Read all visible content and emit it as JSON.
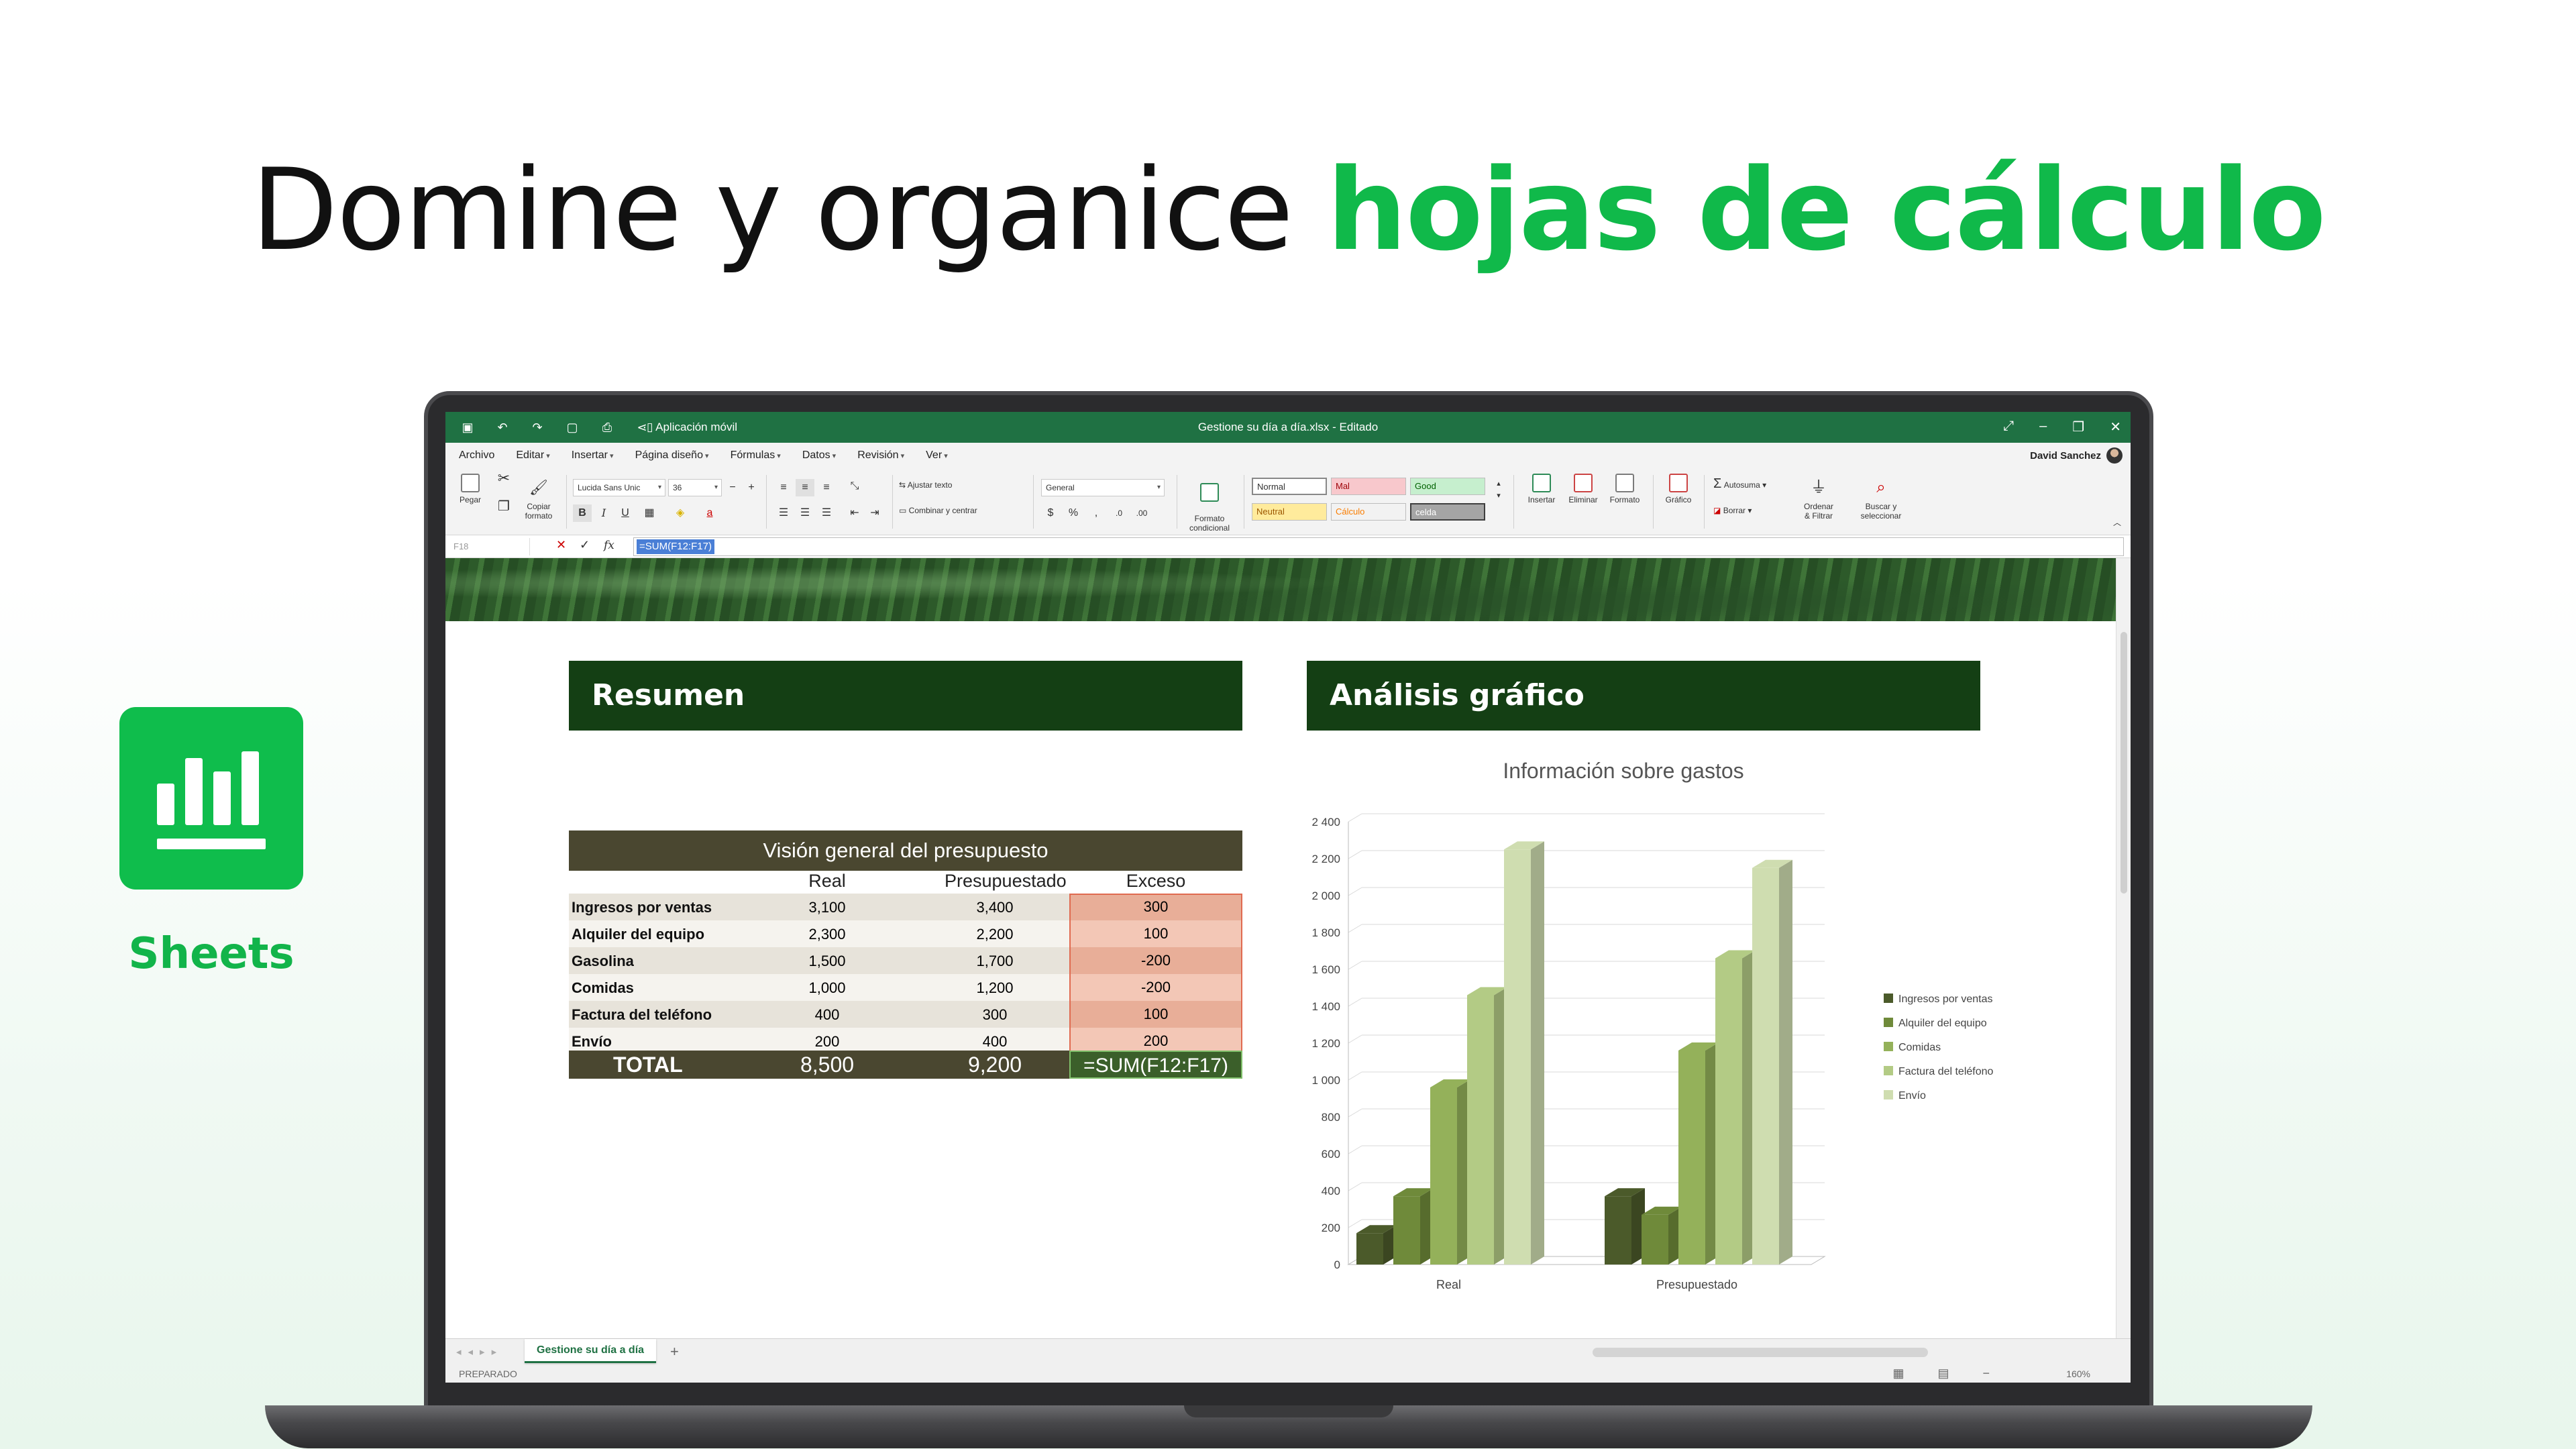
{
  "headline": {
    "part1": "Domine y organice",
    "part2": "hojas de cálculo"
  },
  "app": {
    "name": "Sheets",
    "icon": "bar-chart-icon",
    "color": "#0fbd4c"
  },
  "titlebar": {
    "mobile_label": "Aplicación móvil",
    "title": "Gestione su día a día.xlsx - Editado"
  },
  "menubar": {
    "items": [
      "Archivo",
      "Editar",
      "Insertar",
      "Página diseño",
      "Fórmulas",
      "Datos",
      "Revisión",
      "Ver"
    ],
    "user": "David Sanchez"
  },
  "ribbon": {
    "paste": "Pegar",
    "copy_format": "Copiar\nformato",
    "font": "Lucida Sans Unic",
    "font_size": "36",
    "wrap_text": "Ajustar texto",
    "merge_center": "Combinar y centrar",
    "number_format": "General",
    "conditional_format": "Formato\ncondicional",
    "styles": [
      "Normal",
      "Mal",
      "Good",
      "Neutral",
      "Cálculo",
      "celda"
    ],
    "insert": "Insertar",
    "delete": "Eliminar",
    "format": "Formato",
    "chart": "Gráfico",
    "autosum": "Autosuma",
    "clear": "Borrar",
    "sort_filter": "Ordenar\n& Filtrar",
    "find_select": "Buscar y\nseleccionar"
  },
  "formula_bar": {
    "cell": "F18",
    "formula": "=SUM(F12:F17)"
  },
  "sections": {
    "summary": "Resumen",
    "analysis": "Análisis gráfico"
  },
  "budget": {
    "title": "Visión general del presupuesto",
    "headers": [
      "Real",
      "Presupuestado",
      "Exceso"
    ],
    "rows": [
      {
        "label": "Ingresos por ventas",
        "real": "3,100",
        "pres": "3,400",
        "exc": "300"
      },
      {
        "label": "Alquiler del equipo",
        "real": "2,300",
        "pres": "2,200",
        "exc": "100"
      },
      {
        "label": "Gasolina",
        "real": "1,500",
        "pres": "1,700",
        "exc": "-200"
      },
      {
        "label": "Comidas",
        "real": "1,000",
        "pres": "1,200",
        "exc": "-200"
      },
      {
        "label": "Factura del teléfono",
        "real": "400",
        "pres": "300",
        "exc": "100"
      },
      {
        "label": "Envío",
        "real": "200",
        "pres": "400",
        "exc": "200"
      }
    ],
    "total": {
      "label": "TOTAL",
      "real": "8,500",
      "pres": "9,200",
      "exc": "=SUM(F12:F17)"
    }
  },
  "chart_data": {
    "type": "bar",
    "title": "Información sobre gastos",
    "categories": [
      "Real",
      "Presupuestado"
    ],
    "yticks": [
      "0",
      "200",
      "400",
      "600",
      "800",
      "1 000",
      "1 200",
      "1 400",
      "1 600",
      "1 800",
      "2 000",
      "2 200",
      "2 400"
    ],
    "ylim": [
      0,
      2400
    ],
    "series": [
      {
        "name": "Ingresos por ventas",
        "values": [
          170,
          370
        ],
        "color": "#4b5a2a"
      },
      {
        "name": "Alquiler del equipo",
        "values": [
          370,
          270
        ],
        "color": "#6f8a3a"
      },
      {
        "name": "Comidas",
        "values": [
          960,
          1160
        ],
        "color": "#94b15a"
      },
      {
        "name": "Factura del teléfono",
        "values": [
          1460,
          1660
        ],
        "color": "#b3cb85"
      },
      {
        "name": "Envío",
        "values": [
          2250,
          2150
        ],
        "color": "#cfddb0"
      }
    ],
    "legend": "right",
    "grid": true
  },
  "sheet_tab": "Gestione su día a día",
  "status": {
    "ready": "PREPARADO",
    "zoom": "160%"
  }
}
